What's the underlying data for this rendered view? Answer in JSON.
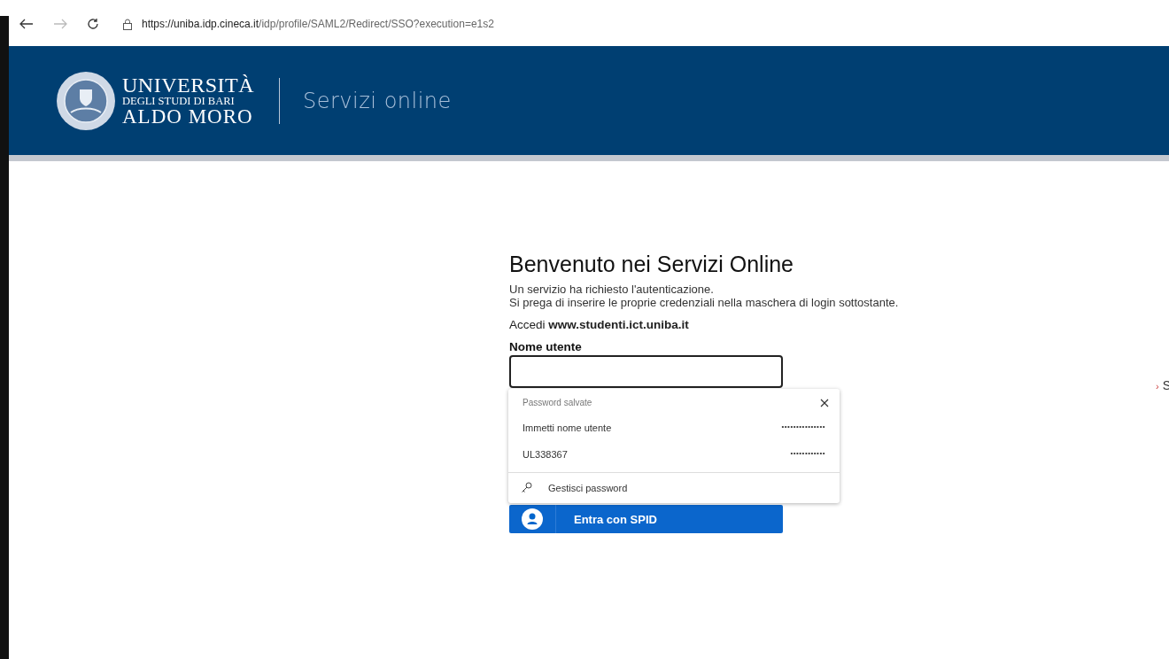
{
  "browser": {
    "url_host": "https://uniba.idp.cineca.it",
    "url_path": "/idp/profile/SAML2/Redirect/SSO?execution=e1s2"
  },
  "header": {
    "logo_line_1": "UNIVERSITÀ",
    "logo_line_2": "DEGLI STUDI DI BARI",
    "logo_line_3": "ALDO MORO",
    "title": "Servizi online"
  },
  "login": {
    "heading": "Benvenuto nei Servizi Online",
    "intro_lines": [
      "Un servizio ha richiesto l'autenticazione.",
      "Si prega di inserire le proprie credenziali nella maschera di login sottostante."
    ],
    "access_label": "Accedi",
    "access_site": "www.studenti.ict.uniba.it",
    "username_label": "Nome utente",
    "spid_button": "Entra con SPID"
  },
  "autofill": {
    "title": "Password salvate",
    "entries": [
      {
        "username": "Immetti nome utente",
        "password": "•••••••••••••••"
      },
      {
        "username": "UL338367",
        "password": "••••••••••••"
      }
    ],
    "manage_label": "Gestisci password"
  },
  "side_link": {
    "chevron": "›",
    "label": "S"
  }
}
